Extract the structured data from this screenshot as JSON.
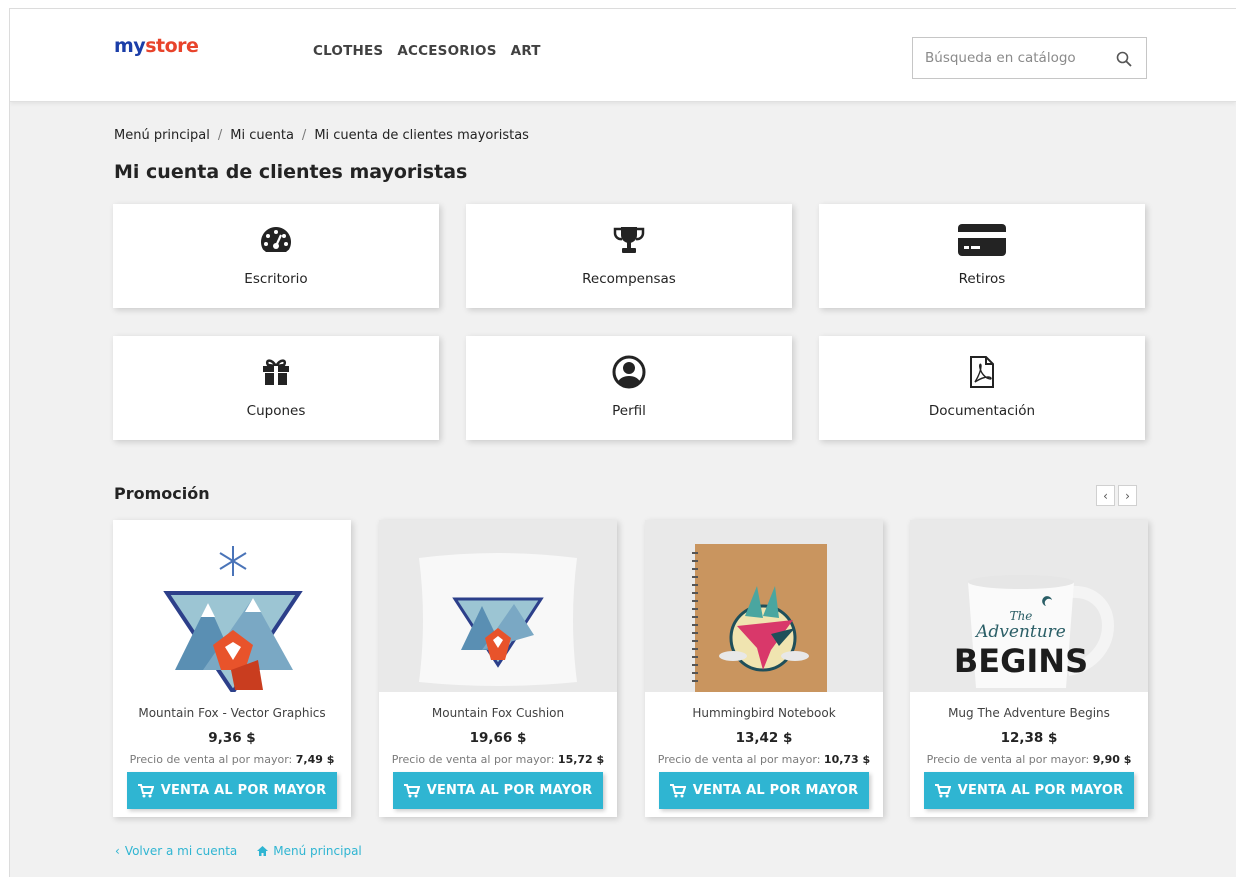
{
  "logo": {
    "text_parts": [
      "my",
      " ",
      "store"
    ]
  },
  "nav": {
    "items": [
      "CLOTHES",
      "ACCESORIOS",
      "ART"
    ]
  },
  "search": {
    "placeholder": "Búsqueda en catálogo"
  },
  "breadcrumb": [
    "Menú principal",
    "Mi cuenta",
    "Mi cuenta de clientes mayoristas"
  ],
  "page_title": "Mi cuenta de clientes mayoristas",
  "tiles": [
    {
      "label": "Escritorio",
      "icon": "dashboard-icon"
    },
    {
      "label": "Recompensas",
      "icon": "trophy-icon"
    },
    {
      "label": "Retiros",
      "icon": "credit-card-icon"
    },
    {
      "label": "Cupones",
      "icon": "gift-icon"
    },
    {
      "label": "Perfil",
      "icon": "user-circle-icon"
    },
    {
      "label": "Documentación",
      "icon": "pdf-file-icon"
    }
  ],
  "promotion": {
    "title": "Promoción",
    "products": [
      {
        "name": "Mountain Fox - Vector Graphics",
        "price": "9,36 $",
        "wholesale_label": "Precio de venta al por mayor:",
        "wholesale_price": "7,49 $",
        "button": "VENTA AL POR MAYOR"
      },
      {
        "name": "Mountain Fox Cushion",
        "price": "19,66 $",
        "wholesale_label": "Precio de venta al por mayor:",
        "wholesale_price": "15,72 $",
        "button": "VENTA AL POR MAYOR"
      },
      {
        "name": "Hummingbird Notebook",
        "price": "13,42 $",
        "wholesale_label": "Precio de venta al por mayor:",
        "wholesale_price": "10,73 $",
        "button": "VENTA AL POR MAYOR"
      },
      {
        "name": "Mug The Adventure Begins",
        "price": "12,38 $",
        "wholesale_label": "Precio de venta al por mayor:",
        "wholesale_price": "9,90 $",
        "button": "VENTA AL POR MAYOR"
      }
    ],
    "mug_text": {
      "line1": "The",
      "line2": "Adventure",
      "line3": "BEGINS"
    }
  },
  "footer": {
    "back_label": "Volver a mi cuenta",
    "home_label": "Menú principal"
  },
  "colors": {
    "accent": "#2fb5d2",
    "text": "#232323",
    "background": "#f1f1f1"
  }
}
